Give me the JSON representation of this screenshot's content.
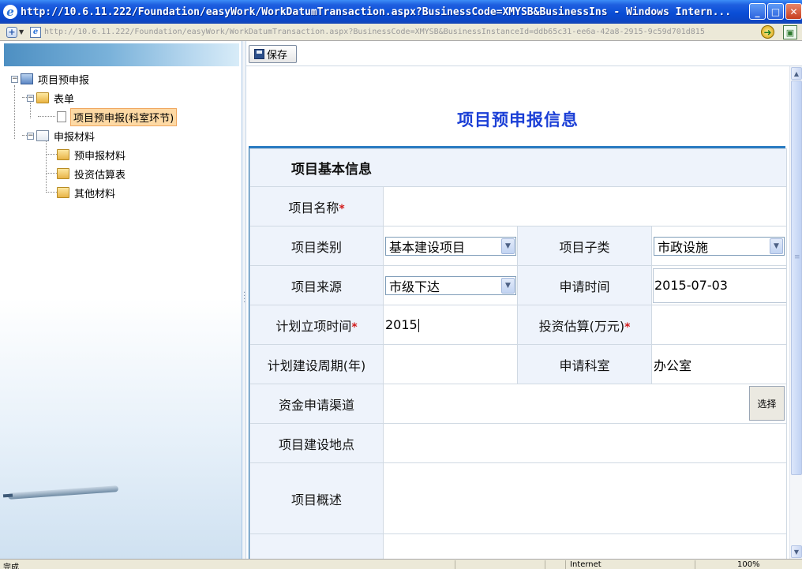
{
  "window": {
    "title": "http://10.6.11.222/Foundation/easyWork/WorkDatumTransaction.aspx?BusinessCode=XMYSB&BusinessIns - Windows Intern...",
    "app_icon": "ie-icon"
  },
  "address_bar": {
    "url": "http://10.6.11.222/Foundation/easyWork/WorkDatumTransaction.aspx?BusinessCode=XMYSB&BusinessInstanceId=ddb65c31-ee6a-42a8-2915-9c59d701d815"
  },
  "tree": {
    "root": "项目预申报",
    "forms_group": "表单",
    "selected_form": "项目预申报(科室环节)",
    "materials_group": "申报材料",
    "materials": [
      "预申报材料",
      "投资估算表",
      "其他材料"
    ]
  },
  "toolbar": {
    "save_label": "保存"
  },
  "page": {
    "title": "项目预申报信息",
    "section": "项目基本信息"
  },
  "form": {
    "project_name_label": "项目名称",
    "project_category_label": "项目类别",
    "project_category_value": "基本建设项目",
    "project_subcategory_label": "项目子类",
    "project_subcategory_value": "市政设施",
    "project_source_label": "项目来源",
    "project_source_value": "市级下达",
    "apply_time_label": "申请时间",
    "apply_time_value": "2015-07-03",
    "planned_time_label": "计划立项时间",
    "planned_time_value": "2015",
    "investment_label": "投资估算(万元)",
    "period_label": "计划建设周期(年)",
    "department_label": "申请科室",
    "department_value": "办公室",
    "funding_label": "资金申请渠道",
    "choose_label": "选择",
    "location_label": "项目建设地点",
    "overview_label": "项目概述",
    "required_mark": "*"
  },
  "status_bar": {
    "status": "完成",
    "zone": "Internet",
    "zoom": "100%"
  }
}
